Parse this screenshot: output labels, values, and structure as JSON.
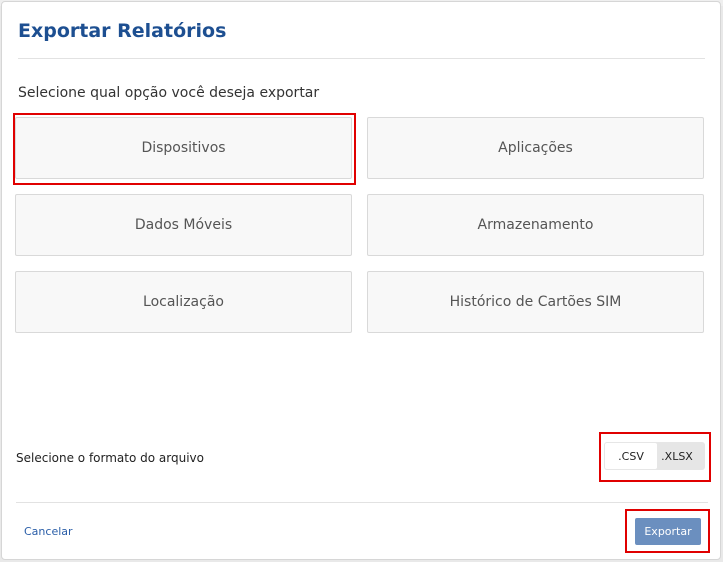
{
  "dialog": {
    "title": "Exportar Relatórios",
    "subtitle": "Selecione qual opção você deseja exportar"
  },
  "options": [
    {
      "label": "Dispositivos",
      "selected": true
    },
    {
      "label": "Aplicações",
      "selected": false
    },
    {
      "label": "Dados Móveis",
      "selected": false
    },
    {
      "label": "Armazenamento",
      "selected": false
    },
    {
      "label": "Localização",
      "selected": false
    },
    {
      "label": "Histórico de Cartões SIM",
      "selected": false
    }
  ],
  "format": {
    "label": "Selecione o formato do arquivo",
    "options": [
      ".CSV",
      ".XLSX"
    ],
    "selected": ".CSV"
  },
  "footer": {
    "cancel_label": "Cancelar",
    "export_label": "Exportar"
  },
  "colors": {
    "title": "#1d4f91",
    "export_button": "#6b8fbf",
    "highlight": "#e00000",
    "link": "#2a5ea8"
  }
}
